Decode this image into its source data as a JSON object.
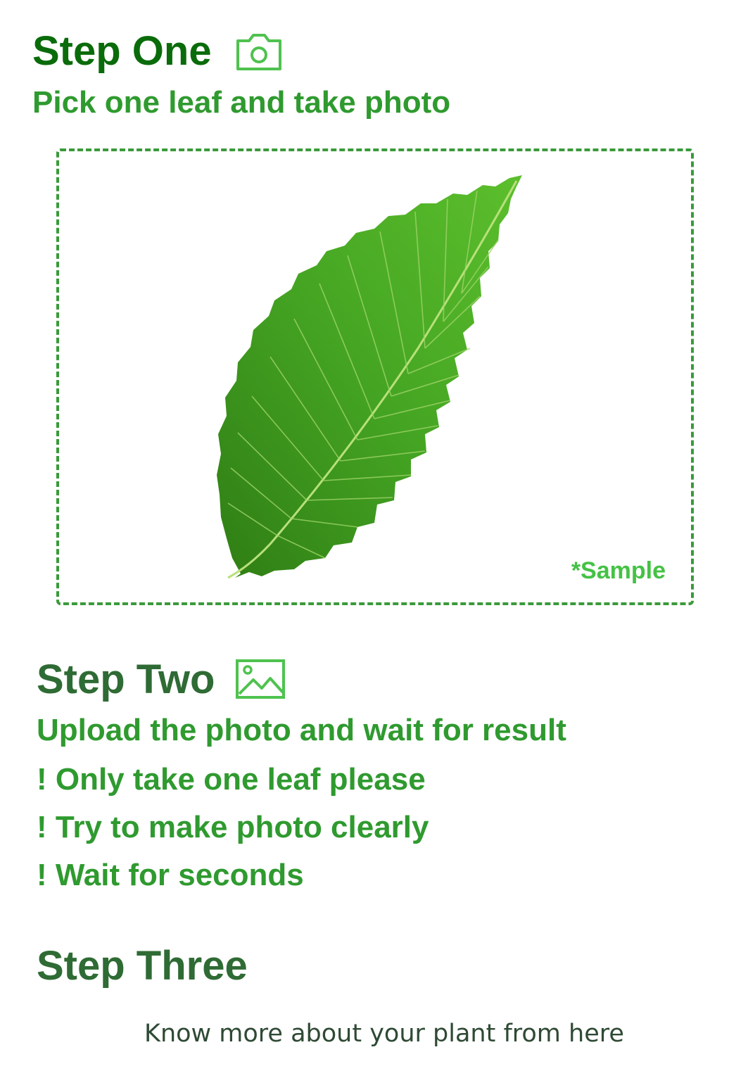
{
  "step_one": {
    "title": "Step One",
    "icon": "camera-icon",
    "subtitle": "Pick one leaf and take photo",
    "sample": {
      "image": "leaf-image",
      "label": "*Sample"
    }
  },
  "step_two": {
    "title": "Step Two",
    "icon": "image-icon",
    "subtitle": "Upload the photo and wait for result",
    "tips": [
      "! Only take one leaf please",
      "! Try to make photo clearly",
      "! Wait for seconds"
    ]
  },
  "step_three": {
    "title": "Step Three",
    "link_text": "Know more about your plant from here"
  },
  "colors": {
    "title_dark_green": "#0a6b0a",
    "title_muted_green": "#2f6b34",
    "text_green": "#2f9a2f",
    "icon_green": "#4fc24f",
    "dashed_border": "#3a9a3a",
    "sample_label": "#44c244",
    "leaf_green": "#3d9b20"
  }
}
